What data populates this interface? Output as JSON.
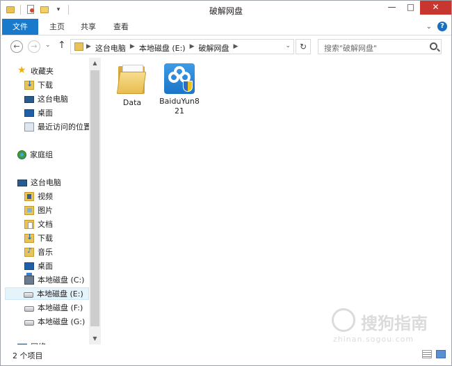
{
  "window": {
    "title": "破解网盘",
    "minimize_glyph": "—",
    "maximize_glyph": "□",
    "close_glyph": "✕"
  },
  "ribbon": {
    "tabs": [
      "文件",
      "主页",
      "共享",
      "查看"
    ],
    "help_glyph": "?",
    "collapse_glyph": "⌄"
  },
  "address": {
    "breadcrumbs": [
      "这台电脑",
      "本地磁盘 (E:)",
      "破解网盘"
    ],
    "separator": "▶",
    "dropdown_glyph": "⌄",
    "refresh_glyph": "↻"
  },
  "search": {
    "placeholder": "搜索\"破解网盘\""
  },
  "nav": {
    "back_glyph": "←",
    "forward_glyph": "→",
    "recent_glyph": "⌄",
    "up_glyph": "↑"
  },
  "navpane": {
    "favorites_label": "收藏夹",
    "favorites": [
      "下载",
      "这台电脑",
      "桌面",
      "最近访问的位置"
    ],
    "homegroup_label": "家庭组",
    "thispc_label": "这台电脑",
    "thispc_items": [
      "视频",
      "图片",
      "文档",
      "下载",
      "音乐",
      "桌面",
      "本地磁盘 (C:)",
      "本地磁盘 (E:)",
      "本地磁盘 (F:)",
      "本地磁盘 (G:)"
    ],
    "network_label": "网络",
    "selected": "本地磁盘 (E:)"
  },
  "files": [
    {
      "name": "Data",
      "type": "folder"
    },
    {
      "name": "BaiduYun821",
      "line1": "BaiduYun8",
      "line2": "21",
      "type": "application"
    }
  ],
  "status": {
    "item_count": "2 个项目"
  },
  "watermark": {
    "brand": "搜狗指南",
    "url": "zhinan.sogou.com"
  },
  "colors": {
    "file_tab_bg": "#1979ca",
    "close_button": "#c7372f",
    "selection": "#e5f3fb"
  }
}
